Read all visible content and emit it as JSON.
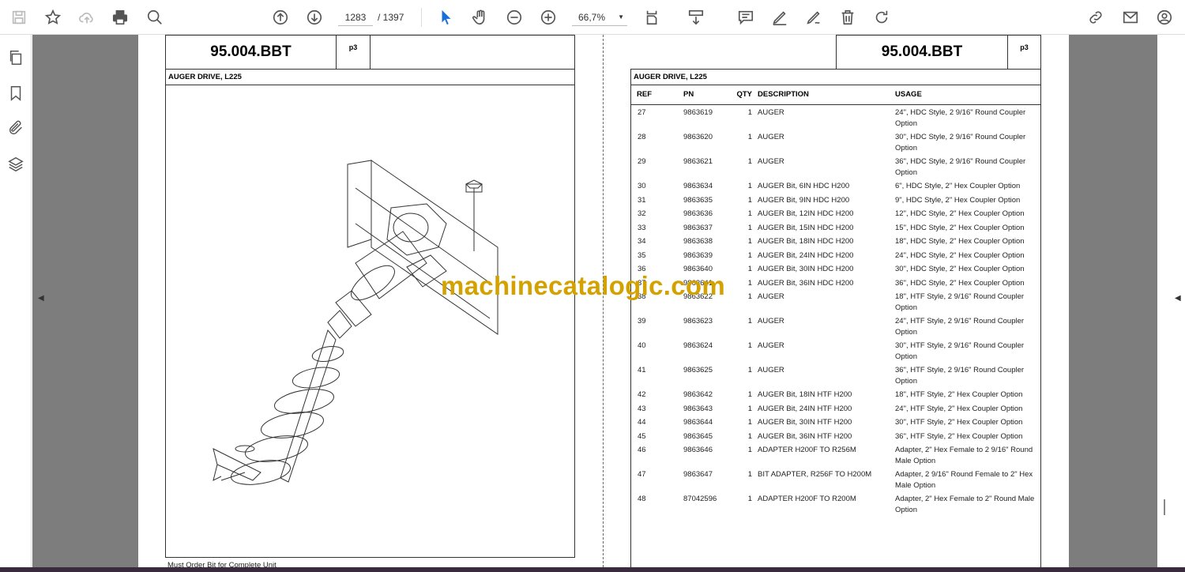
{
  "toolbar": {
    "current_page": "1283",
    "total_pages": "/ 1397",
    "zoom_level": "66,7%",
    "icons": [
      "save-icon",
      "bookmark-star-icon",
      "upload-cloud-icon",
      "print-icon",
      "search-icon",
      "page-up-icon",
      "page-down-icon",
      "select-cursor-icon",
      "hand-icon",
      "zoom-out-icon",
      "zoom-in-icon",
      "fit-page-icon",
      "scroll-mode-icon",
      "comment-icon",
      "highlight-icon",
      "sign-icon",
      "delete-icon",
      "rotate-icon",
      "link-icon",
      "email-icon",
      "account-icon"
    ]
  },
  "sidebar": {
    "icons": [
      "pages-icon",
      "bookmark-icon",
      "attachment-icon",
      "layers-icon"
    ]
  },
  "left_page": {
    "code": "95.004.BBT",
    "page_tag": "p3",
    "section_title": "AUGER DRIVE, L225",
    "footer_note": "Must Order Bit for Complete Unit"
  },
  "right_page": {
    "code": "95.004.BBT",
    "page_tag": "p3",
    "section_title": "AUGER DRIVE, L225",
    "columns": {
      "ref": "REF",
      "pn": "PN",
      "qty": "QTY",
      "desc": "DESCRIPTION",
      "usage": "USAGE"
    },
    "rows": [
      {
        "ref": "27",
        "pn": "9863619",
        "qty": "1",
        "desc": "AUGER",
        "usage": "24\", HDC Style, 2 9/16\" Round Coupler Option"
      },
      {
        "ref": "28",
        "pn": "9863620",
        "qty": "1",
        "desc": "AUGER",
        "usage": "30\", HDC Style, 2 9/16\" Round Coupler Option"
      },
      {
        "ref": "29",
        "pn": "9863621",
        "qty": "1",
        "desc": "AUGER",
        "usage": "36\", HDC Style, 2 9/16\" Round Coupler Option"
      },
      {
        "ref": "30",
        "pn": "9863634",
        "qty": "1",
        "desc": "AUGER Bit, 6IN HDC H200",
        "usage": "6\", HDC Style, 2\" Hex Coupler Option"
      },
      {
        "ref": "31",
        "pn": "9863635",
        "qty": "1",
        "desc": "AUGER Bit, 9IN HDC H200",
        "usage": "9\", HDC Style, 2\" Hex Coupler Option"
      },
      {
        "ref": "32",
        "pn": "9863636",
        "qty": "1",
        "desc": "AUGER Bit, 12IN HDC H200",
        "usage": "12\", HDC Style, 2\" Hex Coupler Option"
      },
      {
        "ref": "33",
        "pn": "9863637",
        "qty": "1",
        "desc": "AUGER Bit, 15IN HDC H200",
        "usage": "15\", HDC Style, 2\" Hex Coupler Option"
      },
      {
        "ref": "34",
        "pn": "9863638",
        "qty": "1",
        "desc": "AUGER Bit, 18IN HDC H200",
        "usage": "18\", HDC Style, 2\" Hex Coupler Option"
      },
      {
        "ref": "35",
        "pn": "9863639",
        "qty": "1",
        "desc": "AUGER Bit, 24IN HDC H200",
        "usage": "24\", HDC Style, 2\" Hex Coupler Option"
      },
      {
        "ref": "36",
        "pn": "9863640",
        "qty": "1",
        "desc": "AUGER Bit, 30IN HDC H200",
        "usage": "30\", HDC Style, 2\" Hex Coupler Option"
      },
      {
        "ref": "37",
        "pn": "9863641",
        "qty": "1",
        "desc": "AUGER Bit, 36IN HDC H200",
        "usage": "36\", HDC Style, 2\" Hex Coupler Option"
      },
      {
        "ref": "38",
        "pn": "9863622",
        "qty": "1",
        "desc": "AUGER",
        "usage": "18\", HTF Style, 2 9/16\" Round Coupler Option"
      },
      {
        "ref": "39",
        "pn": "9863623",
        "qty": "1",
        "desc": "AUGER",
        "usage": "24\", HTF Style, 2 9/16\" Round Coupler Option"
      },
      {
        "ref": "40",
        "pn": "9863624",
        "qty": "1",
        "desc": "AUGER",
        "usage": "30\", HTF Style, 2 9/16\" Round Coupler Option"
      },
      {
        "ref": "41",
        "pn": "9863625",
        "qty": "1",
        "desc": "AUGER",
        "usage": "36\", HTF Style, 2 9/16\" Round Coupler Option"
      },
      {
        "ref": "42",
        "pn": "9863642",
        "qty": "1",
        "desc": "AUGER Bit, 18IN HTF H200",
        "usage": "18\", HTF Style, 2\" Hex Coupler Option"
      },
      {
        "ref": "43",
        "pn": "9863643",
        "qty": "1",
        "desc": "AUGER Bit, 24IN HTF H200",
        "usage": "24\", HTF Style, 2\" Hex Coupler Option"
      },
      {
        "ref": "44",
        "pn": "9863644",
        "qty": "1",
        "desc": "AUGER Bit, 30IN HTF H200",
        "usage": "30\", HTF Style, 2\" Hex Coupler Option"
      },
      {
        "ref": "45",
        "pn": "9863645",
        "qty": "1",
        "desc": "AUGER Bit, 36IN HTF H200",
        "usage": "36\", HTF Style, 2\" Hex Coupler Option"
      },
      {
        "ref": "46",
        "pn": "9863646",
        "qty": "1",
        "desc": "ADAPTER H200F TO R256M",
        "usage": "Adapter, 2\" Hex Female to 2 9/16\" Round Male Option"
      },
      {
        "ref": "47",
        "pn": "9863647",
        "qty": "1",
        "desc": "BIT ADAPTER, R256F TO H200M",
        "usage": "Adapter, 2 9/16\" Round Female to 2\" Hex Male Option"
      },
      {
        "ref": "48",
        "pn": "87042596",
        "qty": "1",
        "desc": "ADAPTER H200F TO R200M",
        "usage": "Adapter, 2\" Hex Female to 2\" Round Male Option"
      }
    ]
  },
  "watermark": "machinecatalogic.com"
}
